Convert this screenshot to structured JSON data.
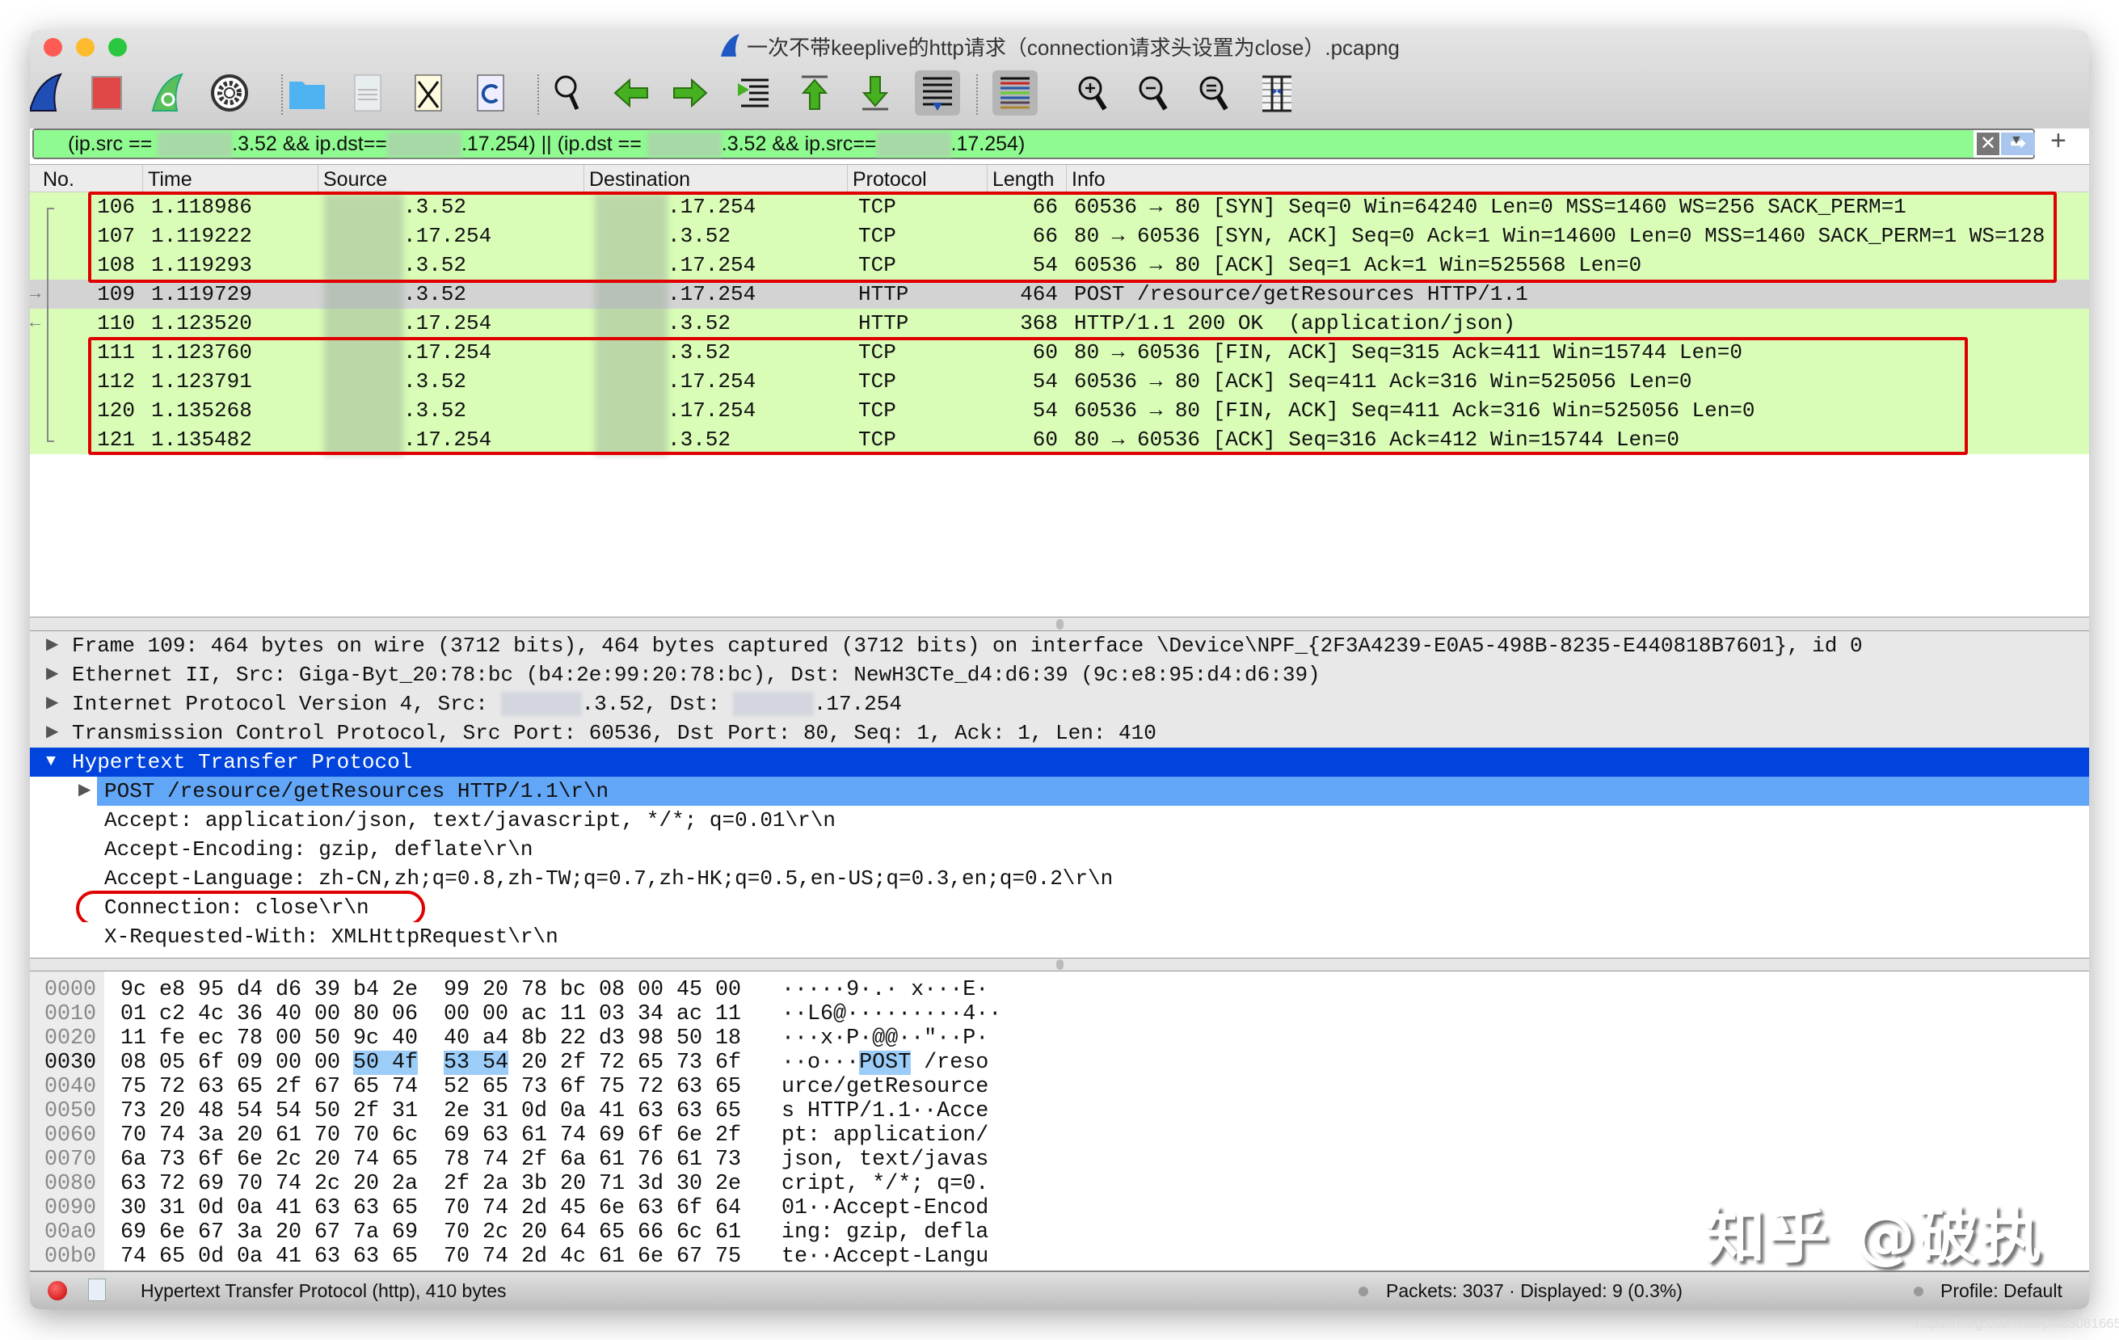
{
  "window": {
    "title": "一次不带keeplive的http请求（connection请求头设置为close）.pcapng"
  },
  "toolbar": {
    "icons": [
      "start-capture-icon",
      "stop-capture-icon",
      "restart-capture-icon",
      "capture-options-icon",
      "open-file-icon",
      "save-file-icon",
      "close-file-icon",
      "reload-file-icon",
      "find-packet-icon",
      "go-back-icon",
      "go-forward-icon",
      "go-to-packet-icon",
      "go-first-icon",
      "go-last-icon",
      "autoscroll-icon",
      "colorize-icon",
      "zoom-in-icon",
      "zoom-out-icon",
      "zoom-normal-icon",
      "resize-columns-icon"
    ],
    "pressed": [
      "autoscroll-icon",
      "colorize-icon"
    ]
  },
  "filter": {
    "parts": [
      "(ip.src == ",
      null,
      ".3.52 && ip.dst==",
      null,
      ".17.254) || (ip.dst == ",
      null,
      ".3.52 && ip.src==",
      null,
      ".17.254)"
    ],
    "add_label": "+"
  },
  "packet_list": {
    "columns": [
      "No.",
      "Time",
      "Source",
      "Destination",
      "Protocol",
      "Length",
      "Info"
    ],
    "rows": [
      {
        "no": "106",
        "time": "1.118986",
        "src": ".3.52",
        "dst": ".17.254",
        "proto": "TCP",
        "len": "66",
        "info": "60536 → 80 [SYN] Seq=0 Win=64240 Len=0 MSS=1460 WS=256 SACK_PERM=1"
      },
      {
        "no": "107",
        "time": "1.119222",
        "src": ".17.254",
        "dst": ".3.52",
        "proto": "TCP",
        "len": "66",
        "info": "80 → 60536 [SYN, ACK] Seq=0 Ack=1 Win=14600 Len=0 MSS=1460 SACK_PERM=1 WS=128"
      },
      {
        "no": "108",
        "time": "1.119293",
        "src": ".3.52",
        "dst": ".17.254",
        "proto": "TCP",
        "len": "54",
        "info": "60536 → 80 [ACK] Seq=1 Ack=1 Win=525568 Len=0"
      },
      {
        "no": "109",
        "time": "1.119729",
        "src": ".3.52",
        "dst": ".17.254",
        "proto": "HTTP",
        "len": "464",
        "info": "POST /resource/getResources HTTP/1.1",
        "selected": true,
        "marker": "→"
      },
      {
        "no": "110",
        "time": "1.123520",
        "src": ".17.254",
        "dst": ".3.52",
        "proto": "HTTP",
        "len": "368",
        "info": "HTTP/1.1 200 OK  (application/json)",
        "marker": "←"
      },
      {
        "no": "111",
        "time": "1.123760",
        "src": ".17.254",
        "dst": ".3.52",
        "proto": "TCP",
        "len": "60",
        "info": "80 → 60536 [FIN, ACK] Seq=315 Ack=411 Win=15744 Len=0"
      },
      {
        "no": "112",
        "time": "1.123791",
        "src": ".3.52",
        "dst": ".17.254",
        "proto": "TCP",
        "len": "54",
        "info": "60536 → 80 [ACK] Seq=411 Ack=316 Win=525056 Len=0"
      },
      {
        "no": "120",
        "time": "1.135268",
        "src": ".3.52",
        "dst": ".17.254",
        "proto": "TCP",
        "len": "54",
        "info": "60536 → 80 [FIN, ACK] Seq=411 Ack=316 Win=525056 Len=0"
      },
      {
        "no": "121",
        "time": "1.135482",
        "src": ".17.254",
        "dst": ".3.52",
        "proto": "TCP",
        "len": "60",
        "info": "80 → 60536 [ACK] Seq=316 Ack=412 Win=15744 Len=0"
      }
    ]
  },
  "details": [
    {
      "level": 0,
      "toggle": "collapsed",
      "parts": [
        "Frame 109: 464 bytes on wire (3712 bits), 464 bytes captured (3712 bits) on interface \\Device\\NPF_{2F3A4239-E0A5-498B-8235-E440818B7601}, id 0"
      ]
    },
    {
      "level": 0,
      "toggle": "collapsed",
      "parts": [
        "Ethernet II, Src: Giga-Byt_20:78:bc (b4:2e:99:20:78:bc), Dst: NewH3CTe_d4:d6:39 (9c:e8:95:d4:d6:39)"
      ]
    },
    {
      "level": 0,
      "toggle": "collapsed",
      "parts": [
        "Internet Protocol Version 4, Src: ",
        null,
        ".3.52, Dst: ",
        null,
        ".17.254"
      ]
    },
    {
      "level": 0,
      "toggle": "collapsed",
      "parts": [
        "Transmission Control Protocol, Src Port: 60536, Dst Port: 80, Seq: 1, Ack: 1, Len: 410"
      ]
    },
    {
      "level": 0,
      "toggle": "expanded",
      "selected": "primary",
      "parts": [
        "Hypertext Transfer Protocol"
      ]
    },
    {
      "level": 1,
      "toggle": "collapsed",
      "selected": "secondary",
      "parts": [
        "POST /resource/getResources HTTP/1.1\\r\\n"
      ]
    },
    {
      "level": 1,
      "parts": [
        "Accept: application/json, text/javascript, */*; q=0.01\\r\\n"
      ]
    },
    {
      "level": 1,
      "parts": [
        "Accept-Encoding: gzip, deflate\\r\\n"
      ]
    },
    {
      "level": 1,
      "parts": [
        "Accept-Language: zh-CN,zh;q=0.8,zh-TW;q=0.7,zh-HK;q=0.5,en-US;q=0.3,en;q=0.2\\r\\n"
      ]
    },
    {
      "level": 1,
      "parts": [
        "Connection: close\\r\\n"
      ],
      "annotated": true
    },
    {
      "level": 1,
      "parts": [
        "X-Requested-With: XMLHttpRequest\\r\\n"
      ]
    }
  ],
  "hex": {
    "highlight": {
      "row": 3,
      "start": 6,
      "end": 9
    },
    "rows": [
      {
        "offset": "0000",
        "bytes": "9c e8 95 d4 d6 39 b4 2e 99 20 78 bc 08 00 45 00",
        "ascii": "·····9·.· x···E·"
      },
      {
        "offset": "0010",
        "bytes": "01 c2 4c 36 40 00 80 06 00 00 ac 11 03 34 ac 11",
        "ascii": "··L6@·········4··"
      },
      {
        "offset": "0020",
        "bytes": "11 fe ec 78 00 50 9c 40 40 a4 8b 22 d3 98 50 18",
        "ascii": "···x·P·@@··\"··P·"
      },
      {
        "offset": "0030",
        "bytes": "08 05 6f 09 00 00 50 4f 53 54 20 2f 72 65 73 6f",
        "ascii": "··o···POST /reso"
      },
      {
        "offset": "0040",
        "bytes": "75 72 63 65 2f 67 65 74 52 65 73 6f 75 72 63 65",
        "ascii": "urce/getResource"
      },
      {
        "offset": "0050",
        "bytes": "73 20 48 54 54 50 2f 31 2e 31 0d 0a 41 63 63 65",
        "ascii": "s HTTP/1.1··Acce"
      },
      {
        "offset": "0060",
        "bytes": "70 74 3a 20 61 70 70 6c 69 63 61 74 69 6f 6e 2f",
        "ascii": "pt: application/"
      },
      {
        "offset": "0070",
        "bytes": "6a 73 6f 6e 2c 20 74 65 78 74 2f 6a 61 76 61 73",
        "ascii": "json, text/javas"
      },
      {
        "offset": "0080",
        "bytes": "63 72 69 70 74 2c 20 2a 2f 2a 3b 20 71 3d 30 2e",
        "ascii": "cript, */*; q=0."
      },
      {
        "offset": "0090",
        "bytes": "30 31 0d 0a 41 63 63 65 70 74 2d 45 6e 63 6f 64",
        "ascii": "01··Accept-Encod"
      },
      {
        "offset": "00a0",
        "bytes": "69 6e 67 3a 20 67 7a 69 70 2c 20 64 65 66 6c 61",
        "ascii": "ing: gzip, defla"
      },
      {
        "offset": "00b0",
        "bytes": "74 65 0d 0a 41 63 63 65 70 74 2d 4c 61 6e 67 75",
        "ascii": "te··Accept-Langu"
      }
    ]
  },
  "status": {
    "field": "Hypertext Transfer Protocol (http), 410 bytes",
    "packets": "Packets: 3037 · Displayed: 9 (0.3%)",
    "profile": "Profile: Default"
  },
  "watermark": {
    "text": "知乎 @破执",
    "url": "https://blog.csdn.net/pl483081665"
  },
  "colors": {
    "row_green": "#d9fcb7",
    "row_selected": "#d3d3d3",
    "tree_selected": "#0044dd",
    "tree_secondary": "#62a6f8",
    "annotation": "#e00000",
    "filter_ok": "#8ffa8f"
  }
}
